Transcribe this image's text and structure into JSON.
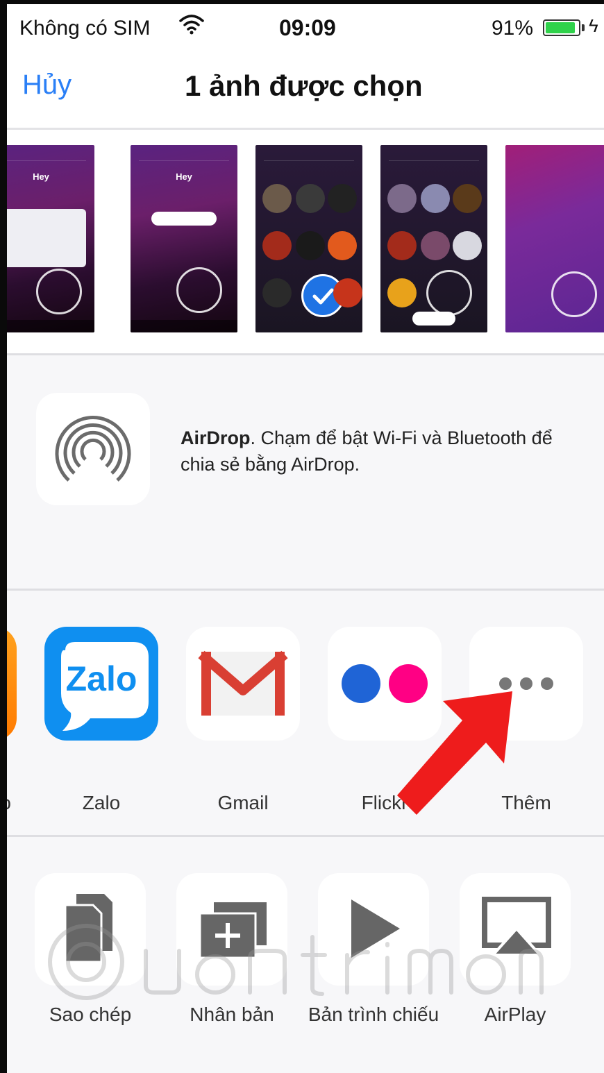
{
  "status_bar": {
    "carrier": "Không có SIM",
    "time": "09:09",
    "battery_percent": "91%",
    "battery_level": 0.91
  },
  "nav": {
    "cancel": "Hủy",
    "title": "1 ảnh được chọn"
  },
  "photos": {
    "items": [
      "screenshot-1",
      "screenshot-2",
      "screenshot-3",
      "screenshot-4",
      "screenshot-5"
    ],
    "selected_index": 2
  },
  "airdrop": {
    "bold": "AirDrop",
    "text": ". Chạm để bật Wi-Fi và Bluetooth để chia sẻ bằng AirDrop."
  },
  "share_apps": [
    {
      "label": "o",
      "icon": "partial-app-icon"
    },
    {
      "label": "Zalo",
      "icon": "zalo-icon",
      "logo_text": "Zalo"
    },
    {
      "label": "Gmail",
      "icon": "gmail-icon"
    },
    {
      "label": "Flickr",
      "icon": "flickr-icon"
    },
    {
      "label": "Thêm",
      "icon": "more-icon"
    }
  ],
  "actions": [
    {
      "label": "Sao chép",
      "icon": "copy-icon"
    },
    {
      "label": "Nhân bản",
      "icon": "duplicate-icon"
    },
    {
      "label": "Bản trình chiếu",
      "icon": "slideshow-icon"
    },
    {
      "label": "AirPlay",
      "icon": "airplay-icon"
    }
  ],
  "colors": {
    "accent": "#2a7ff6",
    "battery": "#2fd24b",
    "arrow": "#ee1c1c",
    "flickr_blue": "#1f64d6",
    "flickr_pink": "#ff0084",
    "zalo_blue": "#0f8ff0",
    "gmail_red": "#d93f33"
  }
}
